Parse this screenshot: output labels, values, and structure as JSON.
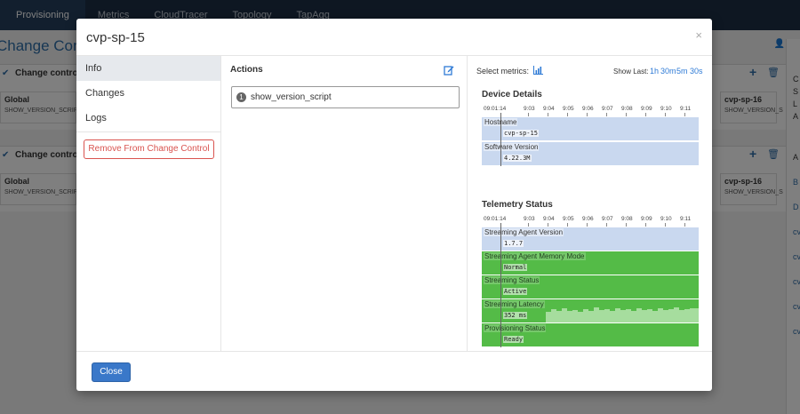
{
  "nav": {
    "tabs": [
      "Provisioning",
      "Metrics",
      "CloudTracer",
      "Topology",
      "TapAgg"
    ]
  },
  "background": {
    "page_title": "Change Control",
    "assign_label": "A",
    "cards": [
      {
        "title": "Change control",
        "left_stage_name": "Global",
        "left_stage_sub": "SHOW_VERSION_SCRIPT",
        "right_stage_name": "cvp-sp-16",
        "right_stage_sub": "SHOW_VERSION_S"
      },
      {
        "title": "Change control",
        "left_stage_name": "Global",
        "left_stage_sub": "SHOW_VERSION_SCRIPT",
        "right_stage_name": "cvp-sp-16",
        "right_stage_sub": "SHOW_VERSION_S"
      }
    ],
    "right_panel": [
      "C",
      "S",
      "L",
      "A",
      "A",
      "B",
      "D",
      "cv",
      "cv",
      "cv",
      "cv",
      "cv",
      "cv"
    ]
  },
  "modal": {
    "title": "cvp-sp-15",
    "close_glyph": "×",
    "sidebar": {
      "items": [
        "Info",
        "Changes",
        "Logs"
      ],
      "remove_label": "Remove From Change Control"
    },
    "actions": {
      "title": "Actions",
      "items": [
        {
          "index": "1",
          "name": "show_version_script"
        }
      ]
    },
    "metrics": {
      "select_label": "Select metrics:",
      "show_last_label": "Show Last:",
      "ranges": [
        "1h",
        "30m",
        "5m",
        "30s"
      ],
      "time_ticks": [
        "09:01:14",
        "9:03",
        "9:04",
        "9:05",
        "9:06",
        "9:07",
        "9:08",
        "9:09",
        "9:10",
        "9:11"
      ],
      "device_details": {
        "title": "Device Details",
        "rows": [
          {
            "label": "Hostname",
            "value": "cvp-sp-15"
          },
          {
            "label": "Software Version",
            "value": "4.22.3M"
          }
        ]
      },
      "telemetry_status": {
        "title": "Telemetry Status",
        "rows": [
          {
            "label": "Streaming Agent Version",
            "value": "1.7.7"
          },
          {
            "label": "Streaming Agent Memory Mode",
            "value": "Normal"
          },
          {
            "label": "Streaming Status",
            "value": "Active"
          },
          {
            "label": "Streaming Latency",
            "value": "352 ms"
          },
          {
            "label": "Provisioning Status",
            "value": "Ready"
          }
        ]
      }
    },
    "footer": {
      "close_label": "Close"
    }
  },
  "colors": {
    "primary": "#3a78c9",
    "danger": "#d9534f",
    "status_ok": "#54bb47",
    "metric_blue": "#c9d8ef",
    "navbar": "#1d2f45"
  }
}
